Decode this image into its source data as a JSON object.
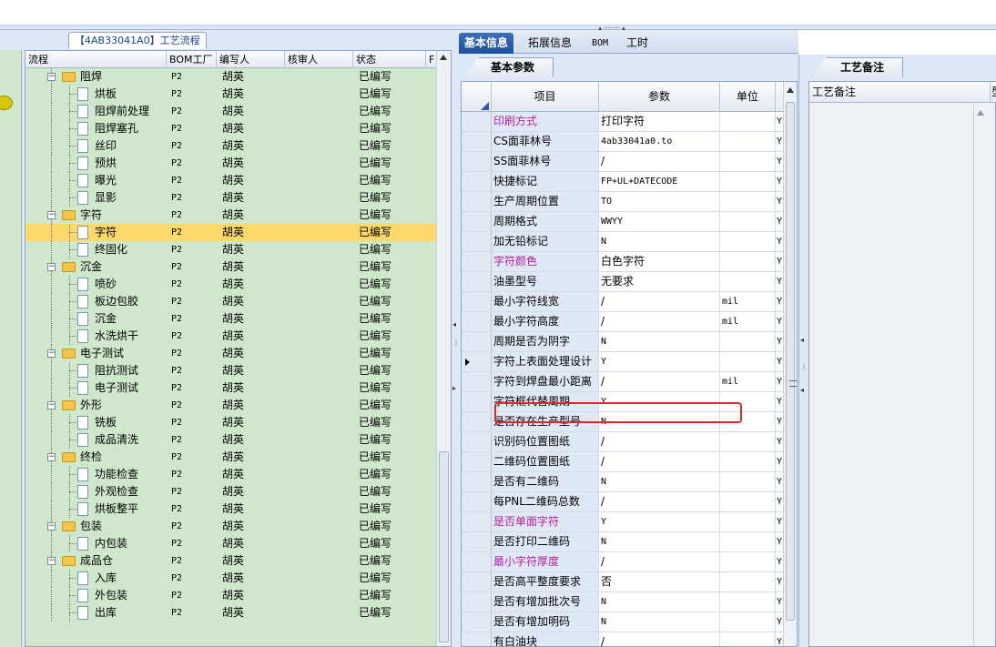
{
  "left_panel": {
    "caption_tab": "【4AB33041A0】工艺流程",
    "columns": {
      "flow": "流程",
      "bom": "BOM工厂",
      "writer": "编写人",
      "reviewer": "核审人",
      "status": "状态",
      "extra": "F"
    }
  },
  "tree_rows": [
    {
      "name": "阻焊",
      "type": "folder",
      "bom": "P2",
      "writer": "胡英",
      "reviewer": "",
      "status": "已编写"
    },
    {
      "name": "烘板",
      "type": "doc",
      "bom": "P2",
      "writer": "胡英",
      "reviewer": "",
      "status": "已编写"
    },
    {
      "name": "阻焊前处理",
      "type": "doc",
      "bom": "P2",
      "writer": "胡英",
      "reviewer": "",
      "status": "已编写"
    },
    {
      "name": "阻焊塞孔",
      "type": "doc",
      "bom": "P2",
      "writer": "胡英",
      "reviewer": "",
      "status": "已编写"
    },
    {
      "name": "丝印",
      "type": "doc",
      "bom": "P2",
      "writer": "胡英",
      "reviewer": "",
      "status": "已编写"
    },
    {
      "name": "预烘",
      "type": "doc",
      "bom": "P2",
      "writer": "胡英",
      "reviewer": "",
      "status": "已编写"
    },
    {
      "name": "曝光",
      "type": "doc",
      "bom": "P2",
      "writer": "胡英",
      "reviewer": "",
      "status": "已编写"
    },
    {
      "name": "显影",
      "type": "doc",
      "bom": "P2",
      "writer": "胡英",
      "reviewer": "",
      "status": "已编写"
    },
    {
      "name": "字符",
      "type": "folder",
      "bom": "P2",
      "writer": "胡英",
      "reviewer": "",
      "status": "已编写"
    },
    {
      "name": "字符",
      "type": "doc",
      "bom": "P2",
      "writer": "胡英",
      "reviewer": "",
      "status": "已编写",
      "selected": true
    },
    {
      "name": "终固化",
      "type": "doc",
      "bom": "P2",
      "writer": "胡英",
      "reviewer": "",
      "status": "已编写"
    },
    {
      "name": "沉金",
      "type": "folder",
      "bom": "P2",
      "writer": "胡英",
      "reviewer": "",
      "status": "已编写"
    },
    {
      "name": "喷砂",
      "type": "doc",
      "bom": "P2",
      "writer": "胡英",
      "reviewer": "",
      "status": "已编写"
    },
    {
      "name": "板边包胶",
      "type": "doc",
      "bom": "P2",
      "writer": "胡英",
      "reviewer": "",
      "status": "已编写"
    },
    {
      "name": "沉金",
      "type": "doc",
      "bom": "P2",
      "writer": "胡英",
      "reviewer": "",
      "status": "已编写"
    },
    {
      "name": "水洗烘干",
      "type": "doc",
      "bom": "P2",
      "writer": "胡英",
      "reviewer": "",
      "status": "已编写"
    },
    {
      "name": "电子测试",
      "type": "folder",
      "bom": "P2",
      "writer": "胡英",
      "reviewer": "",
      "status": "已编写"
    },
    {
      "name": "阻抗测试",
      "type": "doc",
      "bom": "P2",
      "writer": "胡英",
      "reviewer": "",
      "status": "已编写"
    },
    {
      "name": "电子测试",
      "type": "doc",
      "bom": "P2",
      "writer": "胡英",
      "reviewer": "",
      "status": "已编写"
    },
    {
      "name": "外形",
      "type": "folder",
      "bom": "P2",
      "writer": "胡英",
      "reviewer": "",
      "status": "已编写"
    },
    {
      "name": "铣板",
      "type": "doc",
      "bom": "P2",
      "writer": "胡英",
      "reviewer": "",
      "status": "已编写"
    },
    {
      "name": "成品清洗",
      "type": "doc",
      "bom": "P2",
      "writer": "胡英",
      "reviewer": "",
      "status": "已编写"
    },
    {
      "name": "终检",
      "type": "folder",
      "bom": "P2",
      "writer": "胡英",
      "reviewer": "",
      "status": "已编写"
    },
    {
      "name": "功能检查",
      "type": "doc",
      "bom": "P2",
      "writer": "胡英",
      "reviewer": "",
      "status": "已编写"
    },
    {
      "name": "外观检查",
      "type": "doc",
      "bom": "P2",
      "writer": "胡英",
      "reviewer": "",
      "status": "已编写"
    },
    {
      "name": "烘板整平",
      "type": "doc",
      "bom": "P2",
      "writer": "胡英",
      "reviewer": "",
      "status": "已编写"
    },
    {
      "name": "包装",
      "type": "folder",
      "bom": "P2",
      "writer": "胡英",
      "reviewer": "",
      "status": "已编写"
    },
    {
      "name": "内包装",
      "type": "doc",
      "bom": "P2",
      "writer": "胡英",
      "reviewer": "",
      "status": "已编写"
    },
    {
      "name": "成品仓",
      "type": "folder",
      "bom": "P2",
      "writer": "胡英",
      "reviewer": "",
      "status": "已编写"
    },
    {
      "name": "入库",
      "type": "doc",
      "bom": "P2",
      "writer": "胡英",
      "reviewer": "",
      "status": "已编写"
    },
    {
      "name": "外包装",
      "type": "doc",
      "bom": "P2",
      "writer": "胡英",
      "reviewer": "",
      "status": "已编写"
    },
    {
      "name": "出库",
      "type": "doc",
      "bom": "P2",
      "writer": "胡英",
      "reviewer": "",
      "status": "已编写"
    }
  ],
  "tabs": [
    "基本信息",
    "拓展信息",
    "BOM",
    "工时"
  ],
  "subtab": "基本参数",
  "grid_columns": {
    "item": "项目",
    "param": "参数",
    "unit": "单位"
  },
  "grid_rows": [
    {
      "item": "印刷方式",
      "param": "打印字符",
      "unit": "",
      "y": "Y",
      "hl": true
    },
    {
      "item": "CS面菲林号",
      "param": "4ab33041a0.to",
      "unit": "",
      "y": "Y",
      "mono": true
    },
    {
      "item": "SS面菲林号",
      "param": "/",
      "unit": "",
      "y": "Y"
    },
    {
      "item": "快捷标记",
      "param": "FP+UL+DATECODE",
      "unit": "",
      "y": "Y",
      "mono": true
    },
    {
      "item": "生产周期位置",
      "param": "TO",
      "unit": "",
      "y": "Y",
      "mono": true
    },
    {
      "item": "周期格式",
      "param": "WWYY",
      "unit": "",
      "y": "Y",
      "mono": true
    },
    {
      "item": "加无铅标记",
      "param": "N",
      "unit": "",
      "y": "Y",
      "mono": true
    },
    {
      "item": "字符颜色",
      "param": "白色字符",
      "unit": "",
      "y": "Y",
      "hl": true
    },
    {
      "item": "油墨型号",
      "param": "无要求",
      "unit": "",
      "y": "Y"
    },
    {
      "item": "最小字符线宽",
      "param": "/",
      "unit": "mil",
      "y": "Y"
    },
    {
      "item": "最小字符高度",
      "param": "/",
      "unit": "mil",
      "y": "Y"
    },
    {
      "item": "周期是否为阴字",
      "param": "N",
      "unit": "",
      "y": "Y",
      "mono": true
    },
    {
      "item": "字符上表面处理设计",
      "param": "Y",
      "unit": "",
      "y": "Y",
      "mono": true,
      "current": true
    },
    {
      "item": "字符到焊盘最小距离",
      "param": "/",
      "unit": "mil",
      "y": "Y"
    },
    {
      "item": "字符框代替周期",
      "param": "Y",
      "unit": "",
      "y": "Y",
      "mono": true
    },
    {
      "item": "是否存在生产型号",
      "param": "N",
      "unit": "",
      "y": "Y",
      "mono": true
    },
    {
      "item": "识别码位置图纸",
      "param": "/",
      "unit": "",
      "y": "Y"
    },
    {
      "item": "二维码位置图纸",
      "param": "/",
      "unit": "",
      "y": "Y"
    },
    {
      "item": "是否有二维码",
      "param": "N",
      "unit": "",
      "y": "Y",
      "mono": true
    },
    {
      "item": "每PNL二维码总数",
      "param": "/",
      "unit": "",
      "y": "Y"
    },
    {
      "item": "是否单面字符",
      "param": "Y",
      "unit": "",
      "y": "Y",
      "hl": true,
      "mono": true
    },
    {
      "item": "是否打印二维码",
      "param": "N",
      "unit": "",
      "y": "Y",
      "mono": true
    },
    {
      "item": "最小字符厚度",
      "param": "/",
      "unit": "",
      "y": "Y",
      "hl": true
    },
    {
      "item": "是否高平整度要求",
      "param": "否",
      "unit": "",
      "y": "Y"
    },
    {
      "item": "是否有增加批次号",
      "param": "N",
      "unit": "",
      "y": "Y",
      "mono": true
    },
    {
      "item": "是否有增加明码",
      "param": "N",
      "unit": "",
      "y": "Y",
      "mono": true
    },
    {
      "item": "有白油块",
      "param": "/",
      "unit": "",
      "y": "Y"
    }
  ],
  "right_panel": {
    "tab": "工艺备注",
    "column": "工艺备注",
    "column2": "型"
  },
  "colors": {
    "tree_bg": "#cfe8cc",
    "selected_row": "#fcd96a",
    "active_tab": "#2a5aa6",
    "highlight_text": "#b01ea0",
    "red_box": "#d92a2a"
  }
}
